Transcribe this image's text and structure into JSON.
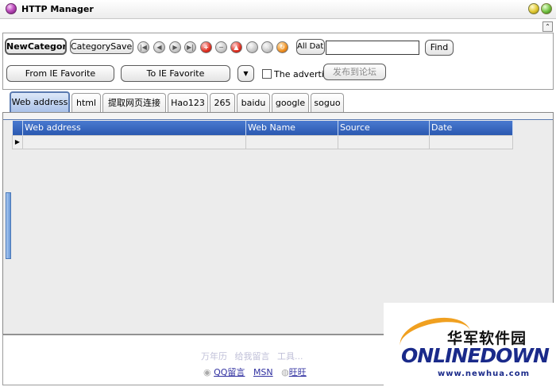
{
  "window": {
    "title": "HTTP Manager"
  },
  "toolbar": {
    "new_category": "NewCategory",
    "category_saves": "CategorySaves",
    "all_data": "All Data",
    "search_value": "",
    "find": "Find",
    "from_ie": "From IE Favorite",
    "to_ie": "To IE Favorite",
    "dropdown_icon": "▼",
    "advertiser_label": "The advertiser",
    "post_forum": "发布到论坛"
  },
  "nav_icons": [
    "first-icon",
    "prev-icon",
    "next-icon",
    "last-icon",
    "add-icon",
    "delete-icon",
    "up-icon",
    "confirm-icon",
    "cancel-icon",
    "refresh-icon"
  ],
  "tabs": [
    "Web address",
    "html",
    "提取网页连接",
    "Hao123",
    "265",
    "baidu",
    "google",
    "soguo"
  ],
  "grid": {
    "columns": [
      "Web address",
      "Web Name",
      "Source",
      "Date"
    ],
    "row_pointer": "▶"
  },
  "footer": {
    "links_row1": [
      "万年历",
      "给我留言",
      "工具..."
    ],
    "qq": "QQ留言",
    "msn": "MSN",
    "wangwang": "旺旺"
  },
  "watermark": {
    "cn": "华军软件园",
    "en": "ONLINEDOWN",
    "url": "www.newhua.com"
  },
  "colors": {
    "grid_header": "#2a58b0",
    "active_tab": "#a8c0e8"
  }
}
